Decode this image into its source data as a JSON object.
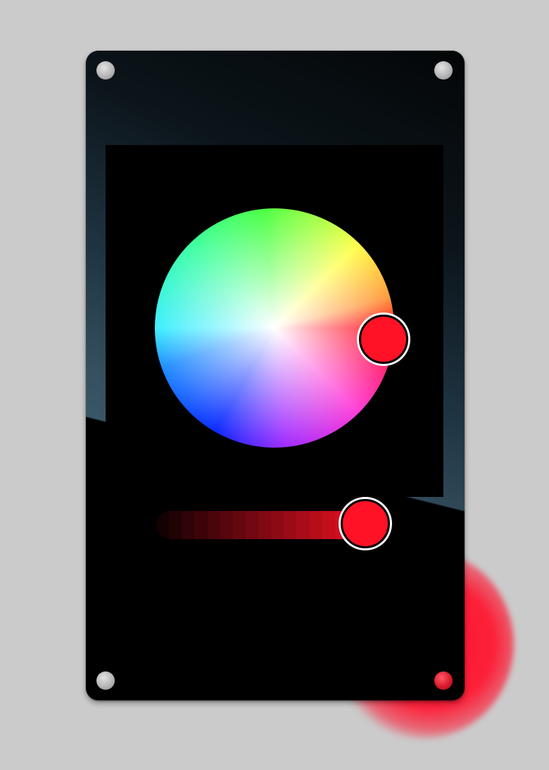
{
  "colors": {
    "background": "#cbcbcb",
    "device": "#000000",
    "selected": "#ff1225",
    "glow": "#ff1630",
    "knob_outline": "#ffffff"
  },
  "color_wheel": {
    "selected_hue_degrees": 354,
    "selected_saturation": 0.97
  },
  "brightness_slider": {
    "value": 1.0
  },
  "icons": {
    "screws": [
      "screw-icon",
      "screw-icon",
      "screw-icon",
      "screw-icon"
    ]
  }
}
